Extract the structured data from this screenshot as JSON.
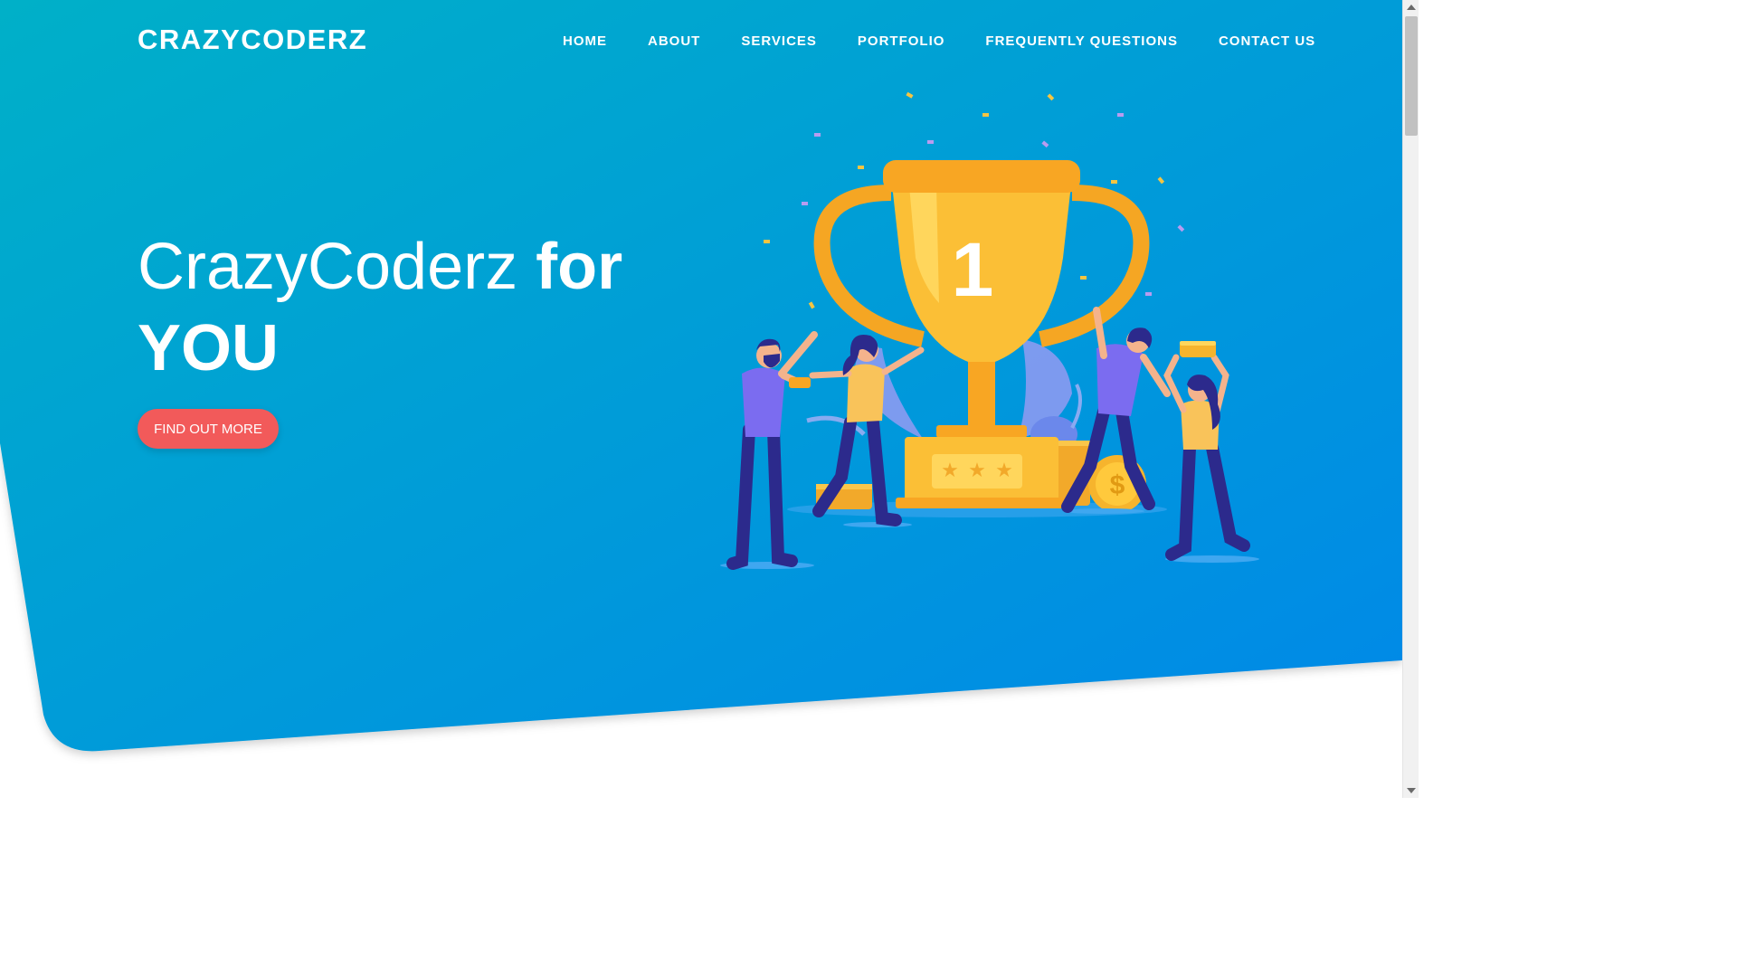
{
  "brand": {
    "name": "CRAZYCODERZ"
  },
  "nav": {
    "items": [
      {
        "label": "HOME"
      },
      {
        "label": "ABOUT"
      },
      {
        "label": "SERVICES"
      },
      {
        "label": "PORTFOLIO"
      },
      {
        "label": "FREQUENTLY QUESTIONS"
      },
      {
        "label": "CONTACT US"
      }
    ]
  },
  "hero": {
    "title_light": "CrazyCoderz",
    "title_bold_1": "for",
    "title_bold_2": "YOU",
    "cta_label": "FIND OUT MORE",
    "trophy_number": "1"
  },
  "colors": {
    "gradient_start": "#00b0c8",
    "gradient_end": "#0288e8",
    "cta": "#f25a5a",
    "trophy": "#fbbf36",
    "figures_dark": "#2c2a8c",
    "figures_shirt_purple": "#7b6cf0",
    "figures_shirt_yellow": "#f9c35a"
  },
  "icons": [
    "trophy-illustration",
    "scroll-up-arrow",
    "scroll-down-arrow"
  ]
}
